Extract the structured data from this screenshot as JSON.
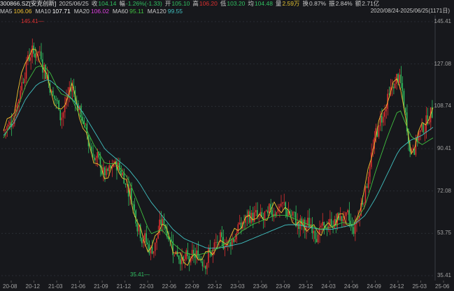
{
  "header": {
    "code": "300866.SZ[安克创新]",
    "date": "2025/06/25",
    "close_label": "收",
    "close": "104.14",
    "change_label": "幅",
    "change": "-1.26%(-1.33)",
    "open_label": "开",
    "open": "105.10",
    "high_label": "高",
    "high": "106.20",
    "low_label": "低",
    "low": "103.20",
    "avg_label": "均",
    "avg": "104.48",
    "volume_label": "量",
    "volume": "2.59万",
    "turnover_label": "换",
    "turnover": "0.87%",
    "amplitude_label": "振",
    "amplitude": "2.84%",
    "amount_label": "额",
    "amount": "2.71亿"
  },
  "ma": [
    {
      "name": "MA5",
      "value": "106.06",
      "color": "#f0c030"
    },
    {
      "name": "MA10",
      "value": "107.71",
      "color": "#ffffff"
    },
    {
      "name": "MA20",
      "value": "106.02",
      "color": "#e040e0"
    },
    {
      "name": "MA60",
      "value": "95.11",
      "color": "#40c040"
    },
    {
      "name": "MA120",
      "value": "99.55",
      "color": "#40c0c0"
    }
  ],
  "range": "2020/08/24-2025/06/25(1171日)",
  "y_ticks": [
    "145.41",
    "127.08",
    "108.74",
    "90.41",
    "72.08",
    "53.75",
    "35.41"
  ],
  "x_ticks": [
    "20-08",
    "20-12",
    "21-03",
    "21-06",
    "21-09",
    "21-12",
    "22-03",
    "22-06",
    "22-09",
    "22-12",
    "23-03",
    "23-06",
    "23-09",
    "23-12",
    "24-03",
    "24-06",
    "24-09",
    "24-12",
    "25-03",
    "25-06"
  ],
  "high_marker": "145.41",
  "low_marker": "35.41",
  "colors": {
    "up": "#e03030",
    "down": "#30c060",
    "bg": "#17181c"
  },
  "chart_data": {
    "type": "line",
    "ylim": [
      35.41,
      145.41
    ],
    "x": [
      "20-08",
      "20-10",
      "20-12",
      "21-02",
      "21-03",
      "21-05",
      "21-06",
      "21-08",
      "21-09",
      "21-11",
      "21-12",
      "22-02",
      "22-03",
      "22-05",
      "22-06",
      "22-08",
      "22-09",
      "22-11",
      "22-12",
      "23-02",
      "23-03",
      "23-05",
      "23-06",
      "23-08",
      "23-09",
      "23-11",
      "23-12",
      "24-02",
      "24-03",
      "24-05",
      "24-06",
      "24-08",
      "24-09",
      "24-11",
      "24-12",
      "25-02",
      "25-03",
      "25-05",
      "25-06"
    ],
    "series": [
      {
        "name": "MA5",
        "values": [
          98,
          108,
          130,
          132,
          118,
          104,
          118,
          100,
          86,
          78,
          84,
          74,
          56,
          46,
          60,
          48,
          42,
          44,
          45,
          49,
          52,
          58,
          62,
          60,
          66,
          64,
          58,
          57,
          55,
          58,
          62,
          56,
          74,
          98,
          112,
          122,
          88,
          100,
          106
        ]
      },
      {
        "name": "MA120",
        "values": [
          96,
          102,
          112,
          118,
          120,
          116,
          112,
          106,
          98,
          90,
          86,
          82,
          76,
          68,
          62,
          56,
          52,
          50,
          48,
          48,
          49,
          50,
          52,
          54,
          56,
          58,
          58,
          57,
          56,
          56,
          57,
          58,
          62,
          70,
          80,
          90,
          94,
          96,
          99.5
        ]
      },
      {
        "name": "MA60",
        "values": [
          95,
          104,
          118,
          126,
          124,
          114,
          112,
          102,
          92,
          84,
          84,
          78,
          66,
          54,
          56,
          50,
          46,
          45,
          46,
          48,
          51,
          55,
          58,
          60,
          62,
          62,
          60,
          58,
          56,
          57,
          59,
          58,
          66,
          82,
          96,
          108,
          96,
          92,
          95
        ]
      }
    ]
  }
}
